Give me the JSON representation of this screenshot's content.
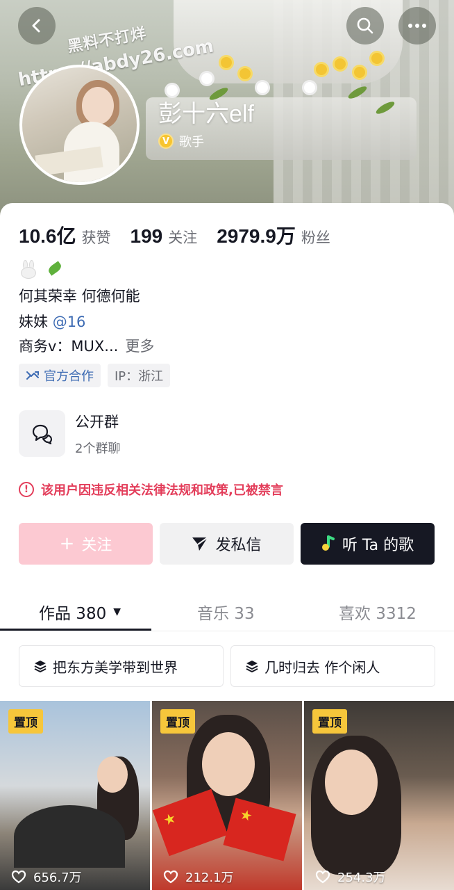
{
  "watermark": {
    "line1": "黑料不打烊",
    "line2": "https://abdy26.com"
  },
  "header": {
    "name": "彭十六elf",
    "verified_label": "歌手",
    "verified_badge": "V"
  },
  "stats": [
    {
      "value": "10.6亿",
      "label": "获赞"
    },
    {
      "value": "199",
      "label": "关注"
    },
    {
      "value": "2979.9万",
      "label": "粉丝"
    }
  ],
  "bio": {
    "line1": "何其荣幸 何德何能",
    "line2_prefix": "妹妹 ",
    "line2_mention": "@16",
    "line3": "商务v：MUX...",
    "more": "更多"
  },
  "tags": {
    "official": "官方合作",
    "ip": "IP：浙江"
  },
  "group": {
    "title": "公开群",
    "subtitle": "2个群聊"
  },
  "banned_notice": "该用户因违反相关法律法规和政策,已被禁言",
  "actions": {
    "follow": "关注",
    "message": "发私信",
    "music": "听 Ta 的歌"
  },
  "tabs": [
    {
      "label": "作品 380"
    },
    {
      "label": "音乐 33"
    },
    {
      "label": "喜欢 3312"
    }
  ],
  "collections": [
    "把东方美学带到世界",
    "几时归去 作个闲人"
  ],
  "videos": [
    {
      "pin": "置顶",
      "likes": "656.7万"
    },
    {
      "pin": "置顶",
      "likes": "212.1万"
    },
    {
      "pin": "置顶",
      "likes": "254.3万"
    }
  ],
  "colors": {
    "accent_pink": "#fcc9d2",
    "warning_red": "#e33d5a",
    "link_blue": "#3d6bb3",
    "pin_yellow": "#f6c63b"
  }
}
